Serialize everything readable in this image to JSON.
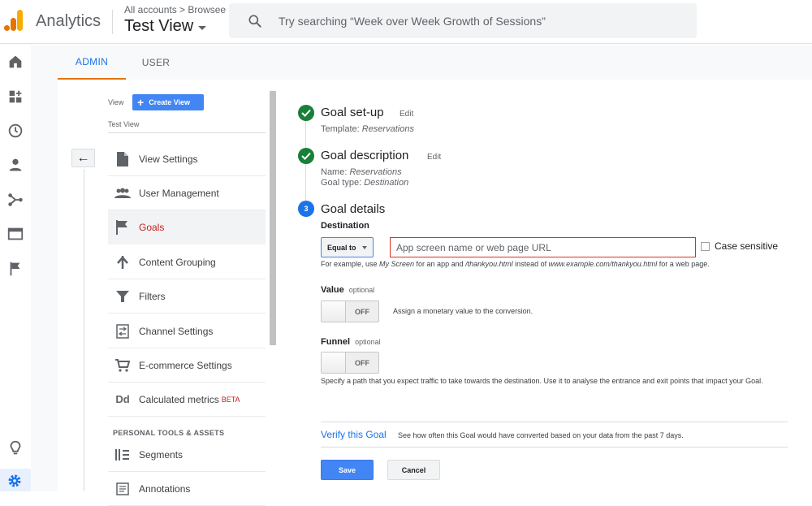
{
  "app": {
    "title": "Analytics",
    "breadcrumb_all": "All accounts",
    "breadcrumb_sep": " > ",
    "breadcrumb_prop": "Browsee",
    "view_name": "Test View"
  },
  "search": {
    "placeholder": "Try searching “Week over Week Growth of Sessions”"
  },
  "tabs": {
    "admin": "ADMIN",
    "user": "USER"
  },
  "view_column": {
    "view_label": "View",
    "create_view": "Create View",
    "view_name": "Test View",
    "back_arrow": "←",
    "items": [
      {
        "label": "View Settings",
        "icon": "document-icon"
      },
      {
        "label": "User Management",
        "icon": "people-icon"
      },
      {
        "label": "Goals",
        "icon": "flag-icon"
      },
      {
        "label": "Content Grouping",
        "icon": "merge-icon"
      },
      {
        "label": "Filters",
        "icon": "filter-icon"
      },
      {
        "label": "Channel Settings",
        "icon": "channel-icon"
      },
      {
        "label": "E-commerce Settings",
        "icon": "cart-icon"
      },
      {
        "label": "Calculated metrics",
        "beta": "BETA",
        "icon": "dd-icon"
      }
    ],
    "section_personal": "PERSONAL TOOLS & ASSETS",
    "items2": [
      {
        "label": "Segments",
        "icon": "segments-icon"
      },
      {
        "label": "Annotations",
        "icon": "annotations-icon"
      }
    ],
    "dd_glyph": "Dd"
  },
  "goal": {
    "setup_title": "Goal set-up",
    "setup_edit": "Edit",
    "template_label": "Template: ",
    "template_value": "Reservations",
    "desc_title": "Goal description",
    "desc_edit": "Edit",
    "name_label": "Name: ",
    "name_value": "Reservations",
    "type_label": "Goal type: ",
    "type_value": "Destination",
    "details_num": "3",
    "details_title": "Goal details",
    "destination_label": "Destination",
    "match_select": "Equal to",
    "destination_placeholder": "App screen name or web page URL",
    "case_sensitive": "Case sensitive",
    "help_1": "For example, use ",
    "help_2": "My Screen",
    "help_3": " for an app and ",
    "help_4": "/thankyou.html",
    "help_5": " instead of ",
    "help_6": "www.example.com/thankyou.html",
    "help_7": " for a web page.",
    "value_label": "Value",
    "value_optional": "optional",
    "value_toggle": "OFF",
    "value_desc": "Assign a monetary value to the conversion.",
    "funnel_label": "Funnel",
    "funnel_optional": "optional",
    "funnel_toggle": "OFF",
    "funnel_desc": "Specify a path that you expect traffic to take towards the destination. Use it to analyse the entrance and exit points that impact your Goal.",
    "verify_link": "Verify this Goal",
    "verify_desc": "See how often this Goal would have converted based on your data from the past 7 days.",
    "save": "Save",
    "cancel": "Cancel"
  },
  "colors": {
    "accent": "#1a73e8",
    "brand_orange": "#e37400",
    "done_green": "#188038",
    "error_red": "#d93025"
  }
}
